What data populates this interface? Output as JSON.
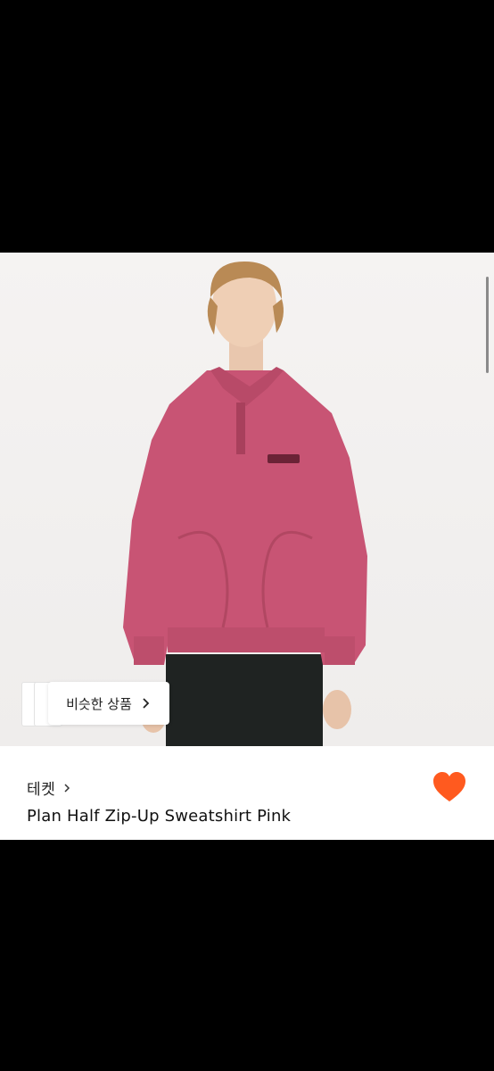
{
  "product": {
    "brand": "테켓",
    "title": "Plan Half Zip-Up Sweatshirt Pink"
  },
  "similar": {
    "label": "비슷한 상품"
  },
  "colors": {
    "heart": "#ff5a1f",
    "sweatshirt": "#c85474"
  },
  "icons": {
    "brand_chevron": "chevron-right-icon",
    "similar_chevron": "chevron-right-icon",
    "favorite": "heart-icon"
  }
}
